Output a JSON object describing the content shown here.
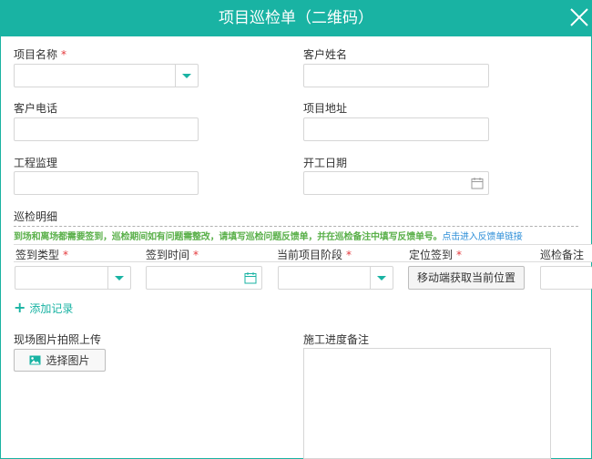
{
  "dialog": {
    "title": "项目巡检单（二维码）",
    "close_icon": "close-icon"
  },
  "form": {
    "project_name": {
      "label": "项目名称",
      "required_mark": "*",
      "value": ""
    },
    "customer_name": {
      "label": "客户姓名",
      "value": ""
    },
    "customer_phone": {
      "label": "客户电话",
      "value": ""
    },
    "project_address": {
      "label": "项目地址",
      "value": ""
    },
    "supervisor": {
      "label": "工程监理",
      "value": ""
    },
    "start_date": {
      "label": "开工日期",
      "value": "",
      "icon": "calendar-icon"
    }
  },
  "inspection": {
    "section_title": "巡检明细",
    "notice": "到场和离场都需要签到，巡检期间如有问题需整改，请填写巡检问题反馈单，并在巡检备注中填写反馈单号。",
    "notice_link": "点击进入反馈单链接",
    "columns": [
      {
        "label": "签到类型",
        "required_mark": "*"
      },
      {
        "label": "签到时间",
        "required_mark": "*"
      },
      {
        "label": "当前项目阶段",
        "required_mark": "*"
      },
      {
        "label": "定位签到",
        "required_mark": "*"
      },
      {
        "label": "巡检备注",
        "required_mark": ""
      }
    ],
    "row": {
      "checkin_type": "",
      "checkin_time": "",
      "project_stage": "",
      "locate_button": "移动端获取当前位置",
      "remark": ""
    },
    "add_record": "添加记录"
  },
  "photos": {
    "label": "现场图片拍照上传",
    "button": "选择图片",
    "icon": "image-icon"
  },
  "progress_notes": {
    "label": "施工进度备注",
    "value": ""
  },
  "colors": {
    "accent": "#19b3a3",
    "required": "#e4393c",
    "notice": "#5ab04a",
    "link": "#2f8fd8"
  }
}
